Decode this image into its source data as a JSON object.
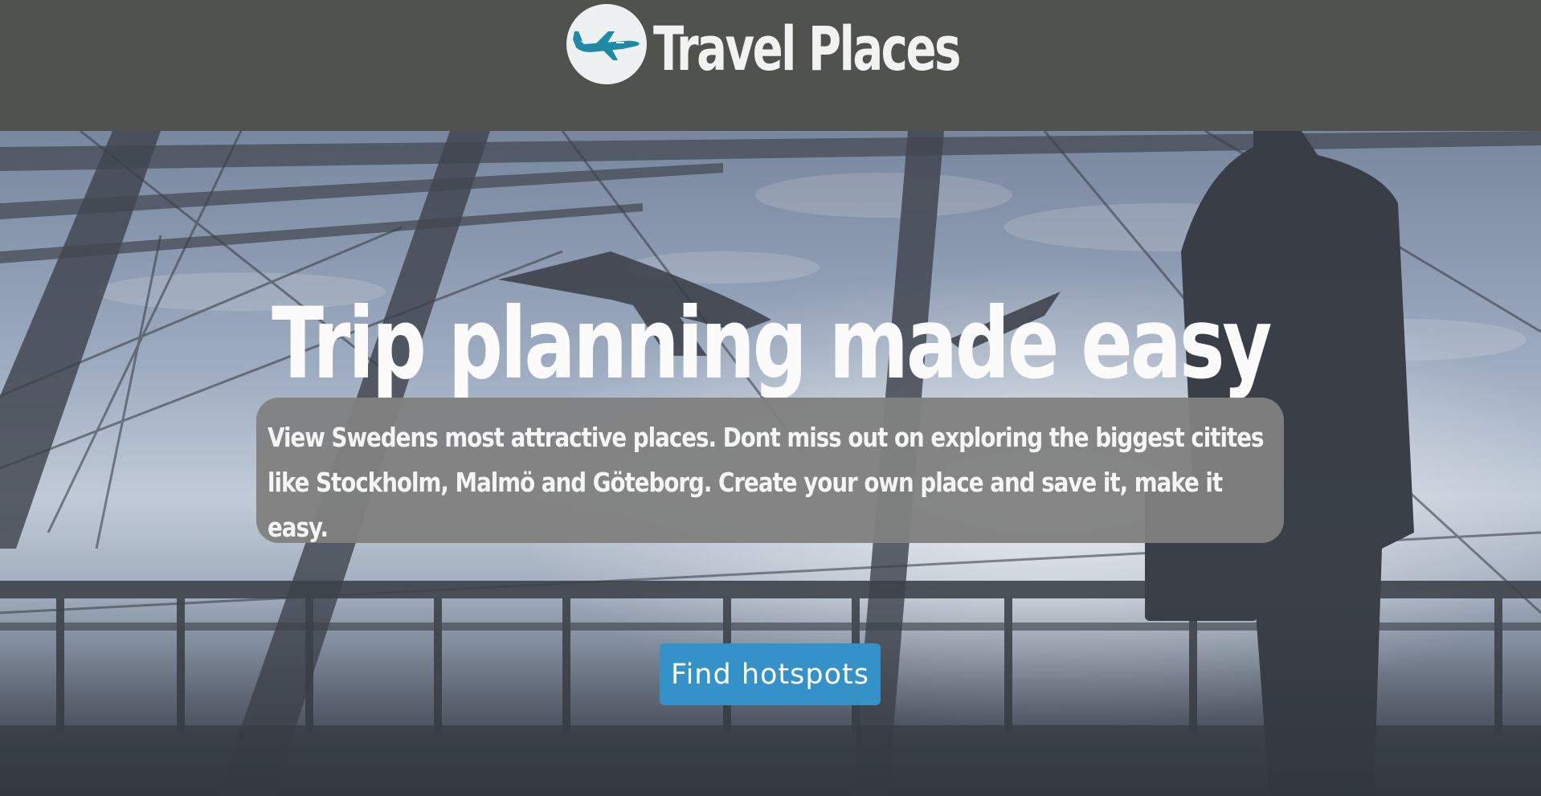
{
  "header": {
    "site_title": "Travel Places",
    "logo_icon": "airplane-logo-icon"
  },
  "hero": {
    "title": "Trip planning made easy",
    "description": "View Swedens most attractive places. Dont miss out on exploring the biggest citites like Stockholm, Malmö and Göteborg. Create your own place and save it, make it easy.",
    "cta_label": "Find hotspots",
    "background_image": "airport-terminal-photo"
  },
  "colors": {
    "header_bg": "#4f524d",
    "box_bg": "#808080",
    "button_bg": "#3592c8",
    "logo_plane": "#1f8aa6"
  }
}
